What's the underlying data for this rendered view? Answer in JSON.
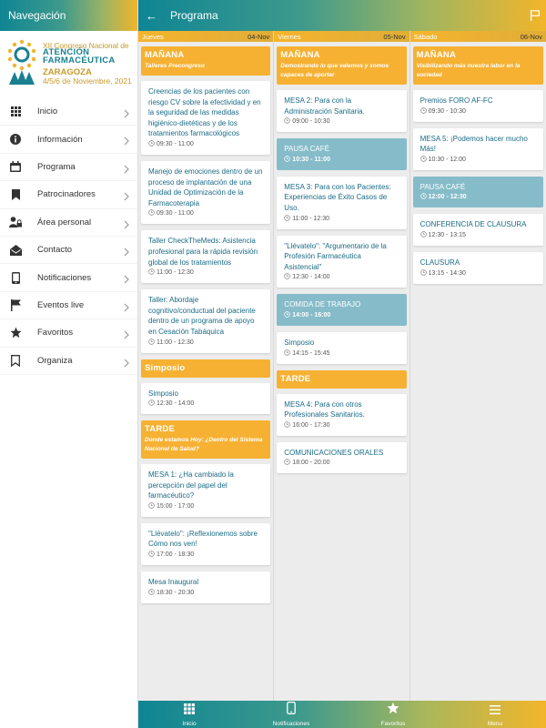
{
  "sidebar": {
    "title": "Navegación",
    "logo": {
      "line1": "XII Congreso Nacional de",
      "line2a": "ATENCIÓN",
      "line2b": "FARMACÉUTICA",
      "line3": "ZARAGOZA",
      "line4": "4/5/6 de Noviembre, 2021"
    },
    "items": [
      {
        "label": "Inicio",
        "icon": "grid-icon"
      },
      {
        "label": "Información",
        "icon": "info-icon"
      },
      {
        "label": "Programa",
        "icon": "calendar-icon"
      },
      {
        "label": "Patrocinadores",
        "icon": "bookmark-icon"
      },
      {
        "label": "Área personal",
        "icon": "user-lock-icon"
      },
      {
        "label": "Contacto",
        "icon": "mail-icon"
      },
      {
        "label": "Notificaciones",
        "icon": "phone-icon"
      },
      {
        "label": "Eventos live",
        "icon": "flag-icon"
      },
      {
        "label": "Favoritos",
        "icon": "star-icon"
      },
      {
        "label": "Organiza",
        "icon": "bookmark-outline-icon"
      }
    ]
  },
  "header": {
    "back": "←",
    "title": "Programa"
  },
  "days": [
    {
      "name": "Jueves",
      "date": "04-Nov",
      "s1": {
        "title": "MAÑANA",
        "subtitle": "Talleres Precongreso"
      },
      "c1": {
        "title": "Creencias de los pacientes con riesgo CV sobre la efectividad y en la seguridad de las medidas higiénico-dietéticas y de los tratamientos farmacológicos",
        "time": "09:30 - 11:00"
      },
      "c2": {
        "title": "Manejo de emociones dentro de un proceso de implantación de una Unidad de Optimización de la Farmacoterapia",
        "time": "09:30 - 11:00"
      },
      "c3": {
        "title": "Taller CheckTheMeds: Asistencia profesional para la rápida revisión global de los tratamientos",
        "time": "11:00 - 12:30"
      },
      "c4": {
        "title": "Taller: Abordaje cognitivo/conductual del paciente dentro de un programa de apoyo en Cesación Tabáquica",
        "time": "11:00 - 12:30"
      },
      "s2": {
        "title": "Simposio"
      },
      "c5": {
        "title": "Simposio",
        "time": "12:30 - 14:00"
      },
      "s3": {
        "title": "TARDE",
        "subtitle": "Donde estamos Hoy: ¿Dentro del Sistema Nacional de Salud?"
      },
      "c6": {
        "title": "MESA 1: ¿Ha cambiado la percepción del papel del farmacéutico?",
        "time": "15:00 - 17:00"
      },
      "c7": {
        "title": "\"Llévatelo\": ¡Reflexionemos sobre Cómo nos ven!",
        "time": "17:00 - 18:30"
      },
      "c8": {
        "title": "Mesa Inaugural",
        "time": "18:30 - 20:30"
      }
    },
    {
      "name": "Viernes",
      "date": "05-Nov",
      "s1": {
        "title": "MAÑANA",
        "subtitle": "Demostrando lo que valemos y somos capaces de aportar"
      },
      "c1": {
        "title": "MESA 2: Para con la Administración Sanitaria.",
        "time": "09:00 - 10:30"
      },
      "p1": {
        "title": "PAUSA CAFÉ",
        "time": "10:30 - 11:00"
      },
      "c2": {
        "title": "MESA 3: Para con los Pacientes: Experiencias de Éxito Casos de Uso.",
        "time": "11:00 - 12:30"
      },
      "c3": {
        "title": "\"Llévatelo\": \"Argumentario de la Profesión Farmacéutica Asistencial\"",
        "time": "12:30 - 14:00"
      },
      "p2": {
        "title": "COMIDA DE TRABAJO",
        "time": "14:00 - 16:00"
      },
      "c4": {
        "title": "Simposio",
        "time": "14:15 - 15:45"
      },
      "s2": {
        "title": "TARDE"
      },
      "c5": {
        "title": "MESA 4: Para con otros Profesionales Sanitarios.",
        "time": "16:00 - 17:30"
      },
      "c6": {
        "title": "COMUNICACIONES ORALES",
        "time": "18:00 - 20:00"
      }
    },
    {
      "name": "Sábado",
      "date": "06-Nov",
      "s1": {
        "title": "MAÑANA",
        "subtitle": "Visibilizando más nuestra labor en la sociedad"
      },
      "c1": {
        "title": "Premios FORO AF-FC",
        "time": "09:30 - 10:30"
      },
      "c2": {
        "title": "MESA 5: ¡Podemos hacer mucho Más!",
        "time": "10:30 - 12:00"
      },
      "p1": {
        "title": "PAUSA CAFÉ",
        "time": "12:00 - 12:30"
      },
      "c3": {
        "title": "CONFERENCIA DE CLAUSURA",
        "time": "12:30 - 13:15"
      },
      "c4": {
        "title": "CLAUSURA",
        "time": "13:15 - 14:30"
      }
    }
  ],
  "bottom": [
    {
      "label": "Inicio",
      "icon": "grid-icon"
    },
    {
      "label": "Notificaciones",
      "icon": "phone-icon"
    },
    {
      "label": "Favoritos",
      "icon": "star-icon"
    },
    {
      "label": "Menu",
      "icon": "hamburger-icon"
    }
  ],
  "colors": {
    "teal": "#0f8594",
    "orange": "#f6b133",
    "pausa": "#86bcc9",
    "link": "#1a6b86"
  }
}
